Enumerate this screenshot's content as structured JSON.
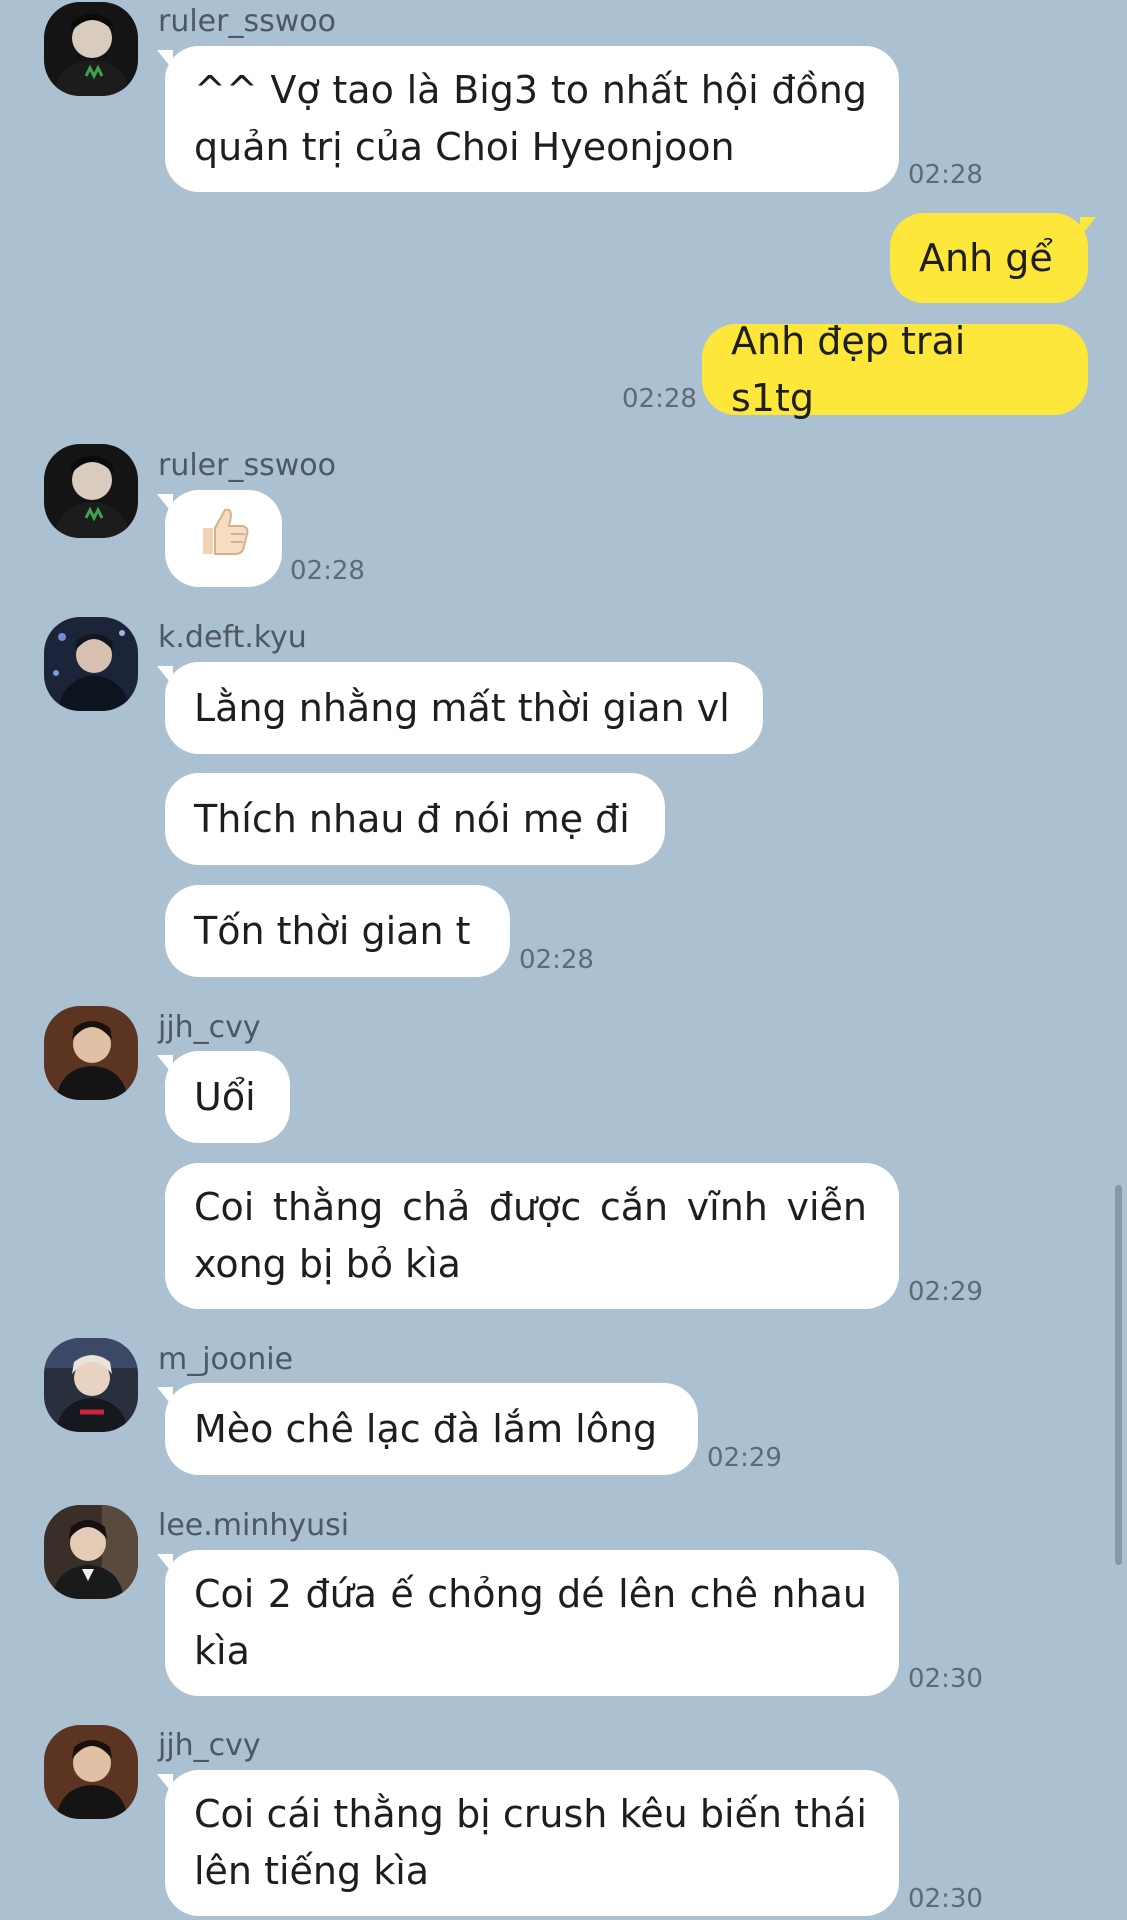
{
  "chat": {
    "messages": [
      {
        "sender": "ruler_sswoo",
        "text": "^^ Vợ tao là Big3 to nhất hội đồng quản trị của Choi Hyeonjoon",
        "time": "02:28"
      },
      {
        "sender": "me",
        "text": "Anh gể",
        "time": ""
      },
      {
        "sender": "me",
        "text": "Anh đẹp trai s1tg",
        "time": "02:28"
      },
      {
        "sender": "ruler_sswoo",
        "text": "👍🏻",
        "time": "02:28"
      },
      {
        "sender": "k.deft.kyu",
        "text": "Lằng nhằng mất thời gian vl",
        "time": ""
      },
      {
        "sender": "k.deft.kyu",
        "text": "Thích nhau đ nói mẹ đi",
        "time": ""
      },
      {
        "sender": "k.deft.kyu",
        "text": "Tốn thời gian t",
        "time": "02:28"
      },
      {
        "sender": "jjh_cvy",
        "text": "Uổi",
        "time": ""
      },
      {
        "sender": "jjh_cvy",
        "text": "Coi thằng chả được cắn vĩnh viễn xong bị bỏ kìa",
        "time": "02:29"
      },
      {
        "sender": "m_joonie",
        "text": "Mèo chê lạc đà lắm lông",
        "time": "02:29"
      },
      {
        "sender": "lee.minhyusi",
        "text": "Coi 2 đứa ế chỏng dé lên chê nhau kìa",
        "time": "02:30"
      },
      {
        "sender": "jjh_cvy",
        "text": "Coi cái thằng bị crush kêu biến thái lên tiếng kìa",
        "time": "02:30"
      }
    ]
  },
  "colors": {
    "background": "#abc1d1",
    "incoming_bubble": "#ffffff",
    "outgoing_bubble": "#fee73b"
  }
}
